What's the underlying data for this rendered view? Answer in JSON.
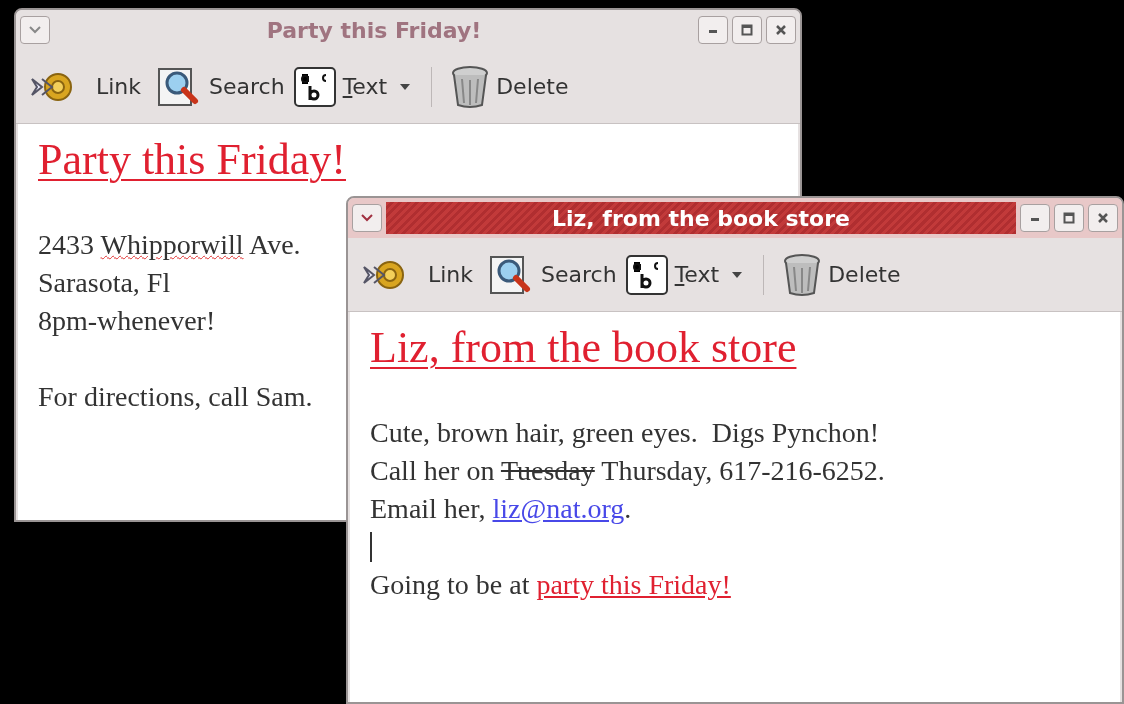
{
  "windows": [
    {
      "title": "Party this Friday!",
      "active": false,
      "toolbar": [
        {
          "kind": "link",
          "label": "Link"
        },
        {
          "kind": "search",
          "label": "Search"
        },
        {
          "kind": "text",
          "label": "Text",
          "mnemonic": true,
          "dropdown": true
        },
        {
          "kind": "separator"
        },
        {
          "kind": "delete",
          "label": "Delete"
        }
      ],
      "note_title": "Party this Friday!",
      "lines": [
        {
          "kind": "blank"
        },
        {
          "kind": "text",
          "segments": [
            {
              "kind": "plain",
              "text": "2433 "
            },
            {
              "kind": "misspelled",
              "text": "Whipporwill"
            },
            {
              "kind": "plain",
              "text": " Ave."
            }
          ]
        },
        {
          "kind": "text",
          "segments": [
            {
              "kind": "plain",
              "text": "Sarasota, Fl"
            }
          ]
        },
        {
          "kind": "text",
          "segments": [
            {
              "kind": "plain",
              "text": "8pm-whenever!"
            }
          ]
        },
        {
          "kind": "blank"
        },
        {
          "kind": "text",
          "segments": [
            {
              "kind": "plain",
              "text": "For directions, call Sam."
            }
          ]
        }
      ]
    },
    {
      "title": "Liz, from the book store",
      "active": true,
      "toolbar": [
        {
          "kind": "link",
          "label": "Link"
        },
        {
          "kind": "search",
          "label": "Search"
        },
        {
          "kind": "text",
          "label": "Text",
          "mnemonic": true,
          "dropdown": true
        },
        {
          "kind": "separator"
        },
        {
          "kind": "delete",
          "label": "Delete"
        }
      ],
      "note_title": "Liz, from the book store",
      "lines": [
        {
          "kind": "blank"
        },
        {
          "kind": "text",
          "segments": [
            {
              "kind": "plain",
              "text": "Cute, brown hair, green eyes.  Digs Pynchon!"
            }
          ]
        },
        {
          "kind": "text",
          "segments": [
            {
              "kind": "plain",
              "text": "Call her on "
            },
            {
              "kind": "struck",
              "text": "Tuesday"
            },
            {
              "kind": "plain",
              "text": " Thursday, 617-216-6252."
            }
          ]
        },
        {
          "kind": "text",
          "segments": [
            {
              "kind": "plain",
              "text": "Email her, "
            },
            {
              "kind": "email",
              "text": "liz@nat.org"
            },
            {
              "kind": "plain",
              "text": "."
            }
          ]
        },
        {
          "kind": "caret"
        },
        {
          "kind": "text",
          "segments": [
            {
              "kind": "plain",
              "text": "Going to be at "
            },
            {
              "kind": "note-link",
              "text": "party this Friday!"
            }
          ]
        }
      ]
    }
  ]
}
